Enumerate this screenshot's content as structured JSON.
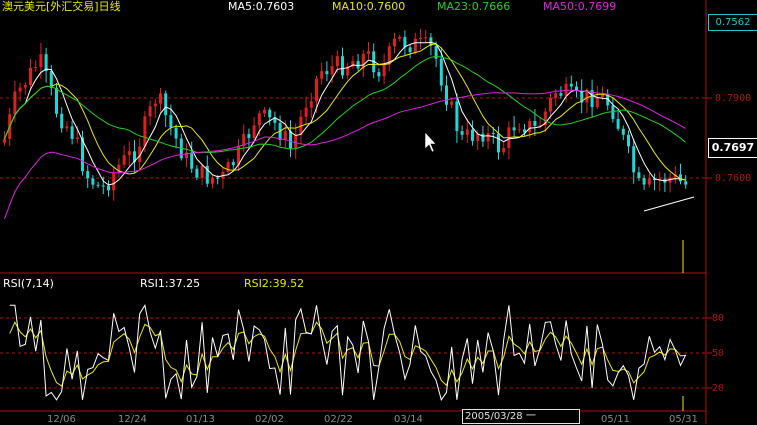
{
  "header": {
    "title": "澳元美元[外汇交易]日线",
    "ma5": "MA5:0.7603",
    "ma10": "MA10:0.7600",
    "ma23": "MA23:0.7666",
    "ma50": "MA50:0.7699"
  },
  "rsi_header": {
    "label": "RSI(7,14)",
    "rsi1": "RSI1:37.25",
    "rsi2": "RSI2:39.52"
  },
  "price_axis": {
    "top_box": "0.7562",
    "current_price_box": "0.7697",
    "ticks": [
      "0.7900",
      "0.7600"
    ]
  },
  "rsi_axis": {
    "ticks": [
      "80",
      "50",
      "20"
    ]
  },
  "date_axis": {
    "labels": [
      "12/06",
      "12/24",
      "01/13",
      "02/02",
      "02/22",
      "03/14",
      "05/11",
      "05/31"
    ],
    "cursor_date": "2005/03/28 一"
  },
  "colors": {
    "background": "#000000",
    "up_candle": "#e02020",
    "down_candle": "#20d8d8",
    "ma5": "#ffffff",
    "ma10": "#e8e800",
    "ma23": "#20d020",
    "ma50": "#e020e0",
    "grid_dash": "#b01010",
    "title": "#e8e800"
  }
}
